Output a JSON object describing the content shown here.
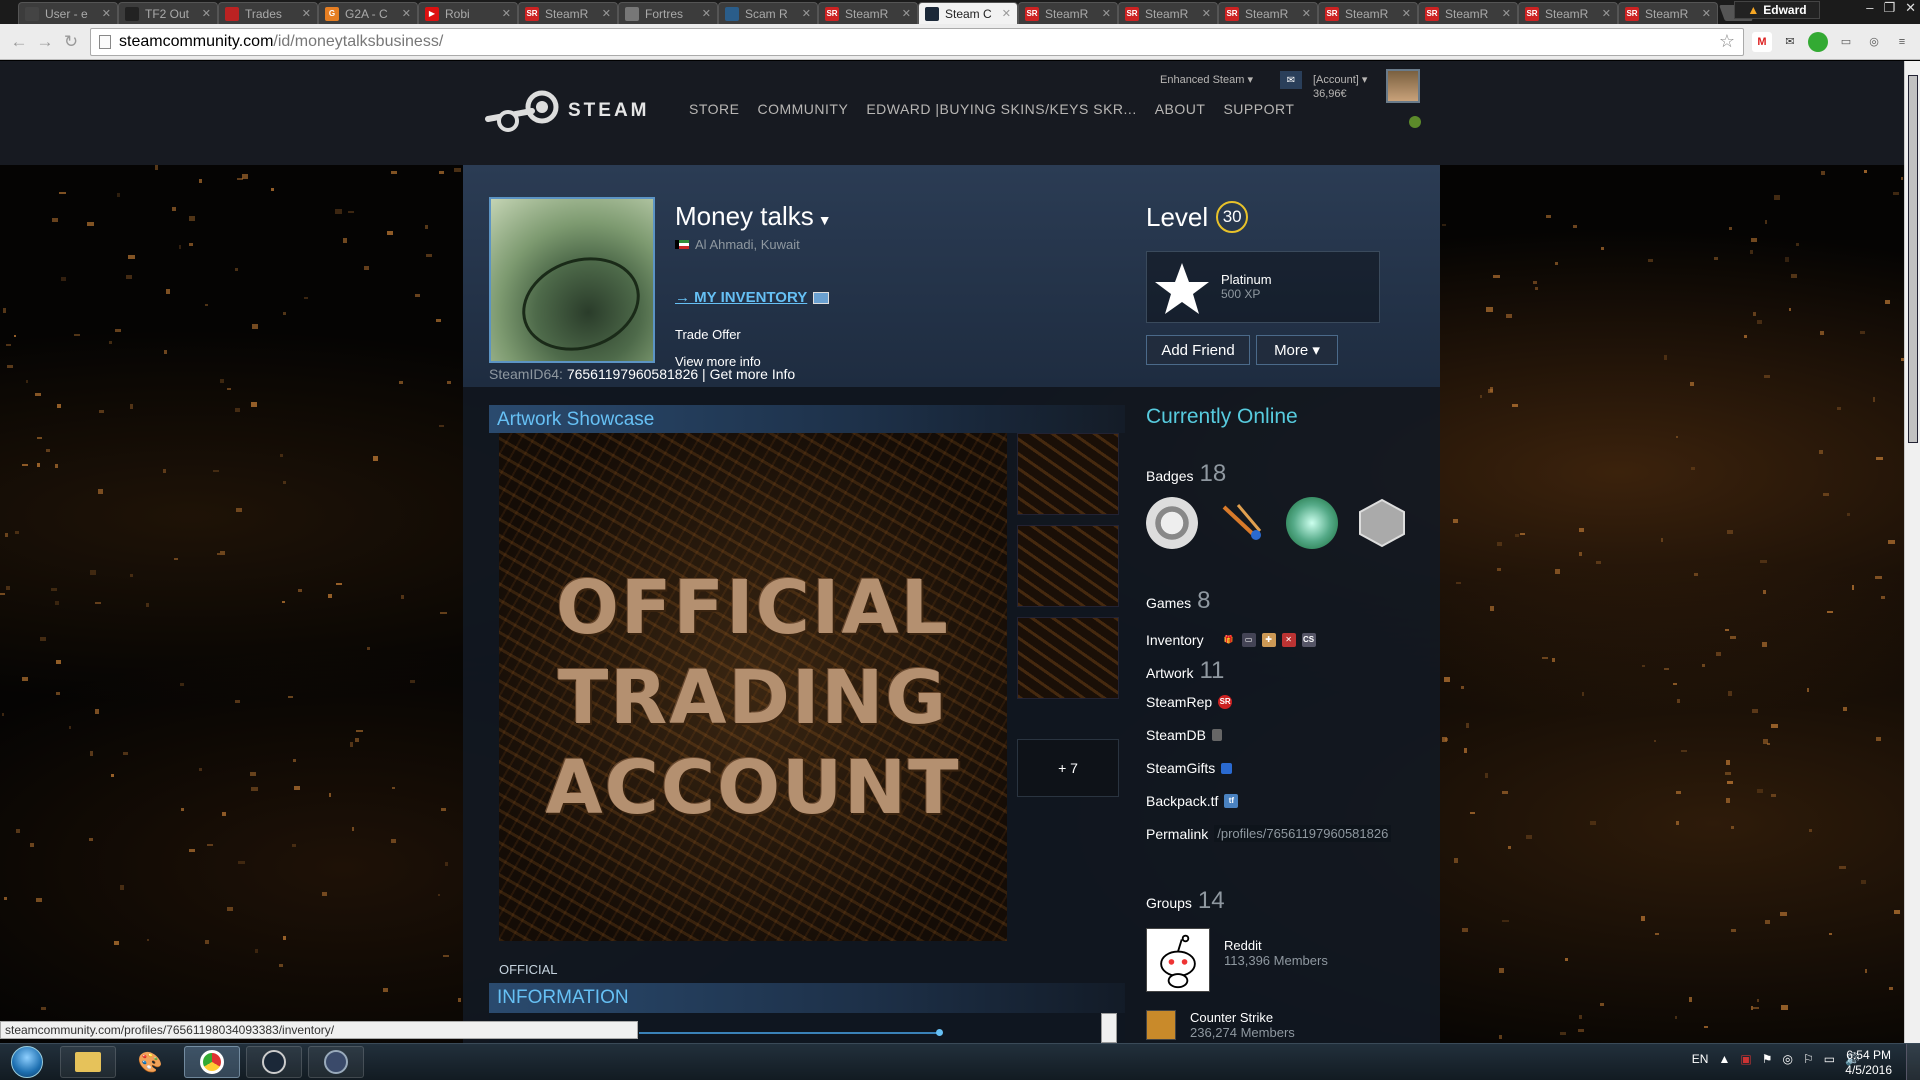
{
  "browser": {
    "tabs": [
      {
        "label": "User - e",
        "fav": "#444",
        "ftxt": "",
        "active": false
      },
      {
        "label": "TF2 Out",
        "fav": "#222",
        "ftxt": "",
        "active": false
      },
      {
        "label": "Trades",
        "fav": "#b22",
        "ftxt": "",
        "active": false
      },
      {
        "label": "G2A - C",
        "fav": "#e67e22",
        "ftxt": "G",
        "active": false
      },
      {
        "label": "Robi",
        "fav": "#d11",
        "ftxt": "▶",
        "active": false
      },
      {
        "label": "SteamR",
        "fav": "#c22",
        "ftxt": "SR",
        "active": false
      },
      {
        "label": "Fortres",
        "fav": "#777",
        "ftxt": "",
        "active": false
      },
      {
        "label": "Scam R",
        "fav": "#2a5d8a",
        "ftxt": "",
        "active": false
      },
      {
        "label": "SteamR",
        "fav": "#c22",
        "ftxt": "SR",
        "active": false
      },
      {
        "label": "Steam C",
        "fav": "#1b2838",
        "ftxt": "",
        "active": true
      },
      {
        "label": "SteamR",
        "fav": "#c22",
        "ftxt": "SR",
        "active": false
      },
      {
        "label": "SteamR",
        "fav": "#c22",
        "ftxt": "SR",
        "active": false
      },
      {
        "label": "SteamR",
        "fav": "#c22",
        "ftxt": "SR",
        "active": false
      },
      {
        "label": "SteamR",
        "fav": "#c22",
        "ftxt": "SR",
        "active": false
      },
      {
        "label": "SteamR",
        "fav": "#c22",
        "ftxt": "SR",
        "active": false
      },
      {
        "label": "SteamR",
        "fav": "#c22",
        "ftxt": "SR",
        "active": false
      },
      {
        "label": "SteamR",
        "fav": "#c22",
        "ftxt": "SR",
        "active": false
      }
    ],
    "user": "Edward",
    "url_host": "steamcommunity.com",
    "url_path": "/id/moneytalksbusiness/",
    "status_url": "steamcommunity.com/profiles/76561198034093383/inventory/"
  },
  "steam_header": {
    "logo_text": "STEAM",
    "nav": [
      "STORE",
      "COMMUNITY",
      "EDWARD |BUYING SKINS/KEYS SKR...",
      "ABOUT",
      "SUPPORT"
    ],
    "enhanced_steam": "Enhanced Steam ▾",
    "account": "[Account] ▾",
    "wallet": "36,96€"
  },
  "profile": {
    "persona_name": "Money talks",
    "location": "Al Ahmadi, Kuwait",
    "summary_link": "→ MY INVENTORY",
    "trade_offer": "Trade Offer",
    "view_more": "View more info",
    "steamid_label": "SteamID64:",
    "steamid_value": "76561197960581826",
    "steamid_sep": "|",
    "get_more_info": "Get more Info",
    "level_label": "Level",
    "level": "30",
    "fav_badge_name": "Platinum",
    "fav_badge_xp": "500 XP",
    "add_friend": "Add Friend",
    "more": "More ▾"
  },
  "showcase": {
    "title": "Artwork Showcase",
    "art_lines": [
      "OFFICIAL",
      "TRADING",
      "ACCOUNT"
    ],
    "more_count": "+ 7",
    "caption": "OFFICIAL",
    "info_title": "INFORMATION"
  },
  "sidebar": {
    "status": "Currently Online",
    "badges_label": "Badges",
    "badges_count": "18",
    "games_label": "Games",
    "games_count": "8",
    "inventory_label": "Inventory",
    "artwork_label": "Artwork",
    "artwork_count": "11",
    "links": [
      "SteamRep",
      "SteamDB",
      "SteamGifts",
      "Backpack.tf"
    ],
    "permalink_label": "Permalink",
    "permalink_value": "/profiles/76561197960581826",
    "groups_label": "Groups",
    "groups_count": "14",
    "groups": [
      {
        "name": "Reddit",
        "members": "113,396 Members"
      },
      {
        "name": "Counter Strike",
        "members": "236,274 Members"
      }
    ]
  },
  "taskbar": {
    "lang": "EN",
    "time": "6:54 PM",
    "date": "4/5/2016"
  }
}
